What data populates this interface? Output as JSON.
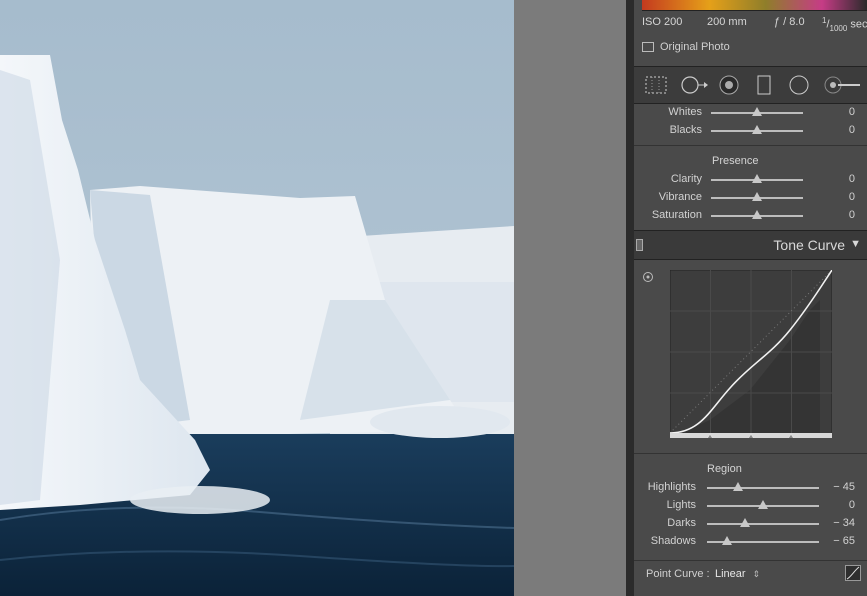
{
  "camera_info": {
    "iso": "ISO 200",
    "focal": "200 mm",
    "aperture": "ƒ / 8.0",
    "shutter_num": "1",
    "shutter_den": "1000",
    "shutter_unit": "sec"
  },
  "original_photo_label": "Original Photo",
  "tools": [
    "crop-overlay-icon",
    "spot-removal-icon",
    "red-eye-icon",
    "graduated-filter-icon",
    "radial-filter-icon",
    "adjustment-brush-icon"
  ],
  "basic": {
    "rows": [
      {
        "label": "Whites",
        "value": "0",
        "level": 0.5
      },
      {
        "label": "Blacks",
        "value": "0",
        "level": 0.5
      }
    ],
    "presence_title": "Presence",
    "presence": [
      {
        "label": "Clarity",
        "value": "0",
        "level": 0.5
      },
      {
        "label": "Vibrance",
        "value": "0",
        "level": 0.5
      },
      {
        "label": "Saturation",
        "value": "0",
        "level": 0.5
      }
    ]
  },
  "tone_curve": {
    "title": "Tone Curve",
    "region_title": "Region",
    "region": [
      {
        "label": "Highlights",
        "value": "− 45",
        "level": 0.28
      },
      {
        "label": "Lights",
        "value": "0",
        "level": 0.5
      },
      {
        "label": "Darks",
        "value": "− 34",
        "level": 0.34
      },
      {
        "label": "Shadows",
        "value": "− 65",
        "level": 0.18
      }
    ],
    "point_curve_label": "Point Curve :",
    "point_curve_value": "Linear"
  }
}
